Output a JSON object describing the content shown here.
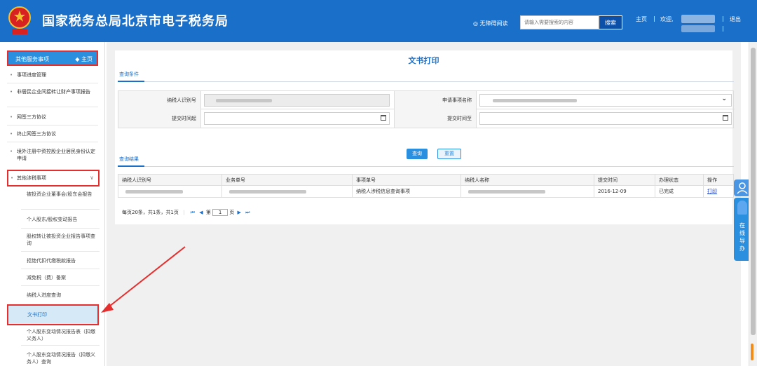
{
  "header": {
    "site_title": "国家税务总局北京市电子税务局",
    "accessibility": "◎ 无障碍阅读",
    "search_placeholder": "请输入需要搜索的内容",
    "search_button": "搜索",
    "home": "主页",
    "welcome": "欢迎,",
    "exit": "退出",
    "sep": "|"
  },
  "sidebar": {
    "header_label": "其他服务事项",
    "header_home": "◆ 主页",
    "items": [
      {
        "label": "事项进度管理"
      },
      {
        "label": "非居民企业间接转让财产事项报告"
      },
      {
        "label": "网签三方协议"
      },
      {
        "label": "终止网签三方协议"
      },
      {
        "label": "境外注册中资控股企业居民身份认定申请"
      }
    ],
    "group_label": "其他涉税事项",
    "sub_items": [
      {
        "label": "被投资企业董事会/股东会报告"
      },
      {
        "label": "个人股东/股权变动报告"
      },
      {
        "label": "股权转让被投资企业报告事项查询"
      },
      {
        "label": "拒绝代扣代缴税款报告"
      },
      {
        "label": "减免税（费）备案"
      },
      {
        "label": "纳税人进度查询"
      },
      {
        "label": "文书打印"
      },
      {
        "label": "个人股东变动情况报告表（扣缴义务人）"
      },
      {
        "label": "个人股东变动情况报告（扣缴义务人）查询"
      }
    ]
  },
  "main": {
    "title": "文书打印",
    "query_tab": "查询条件",
    "result_tab": "查询结果",
    "form": {
      "taxpayer_id_label": "纳税人识别号",
      "apply_item_label": "申请事项名称",
      "start_time_label": "提交时间起",
      "end_time_label": "提交时间至"
    },
    "query_button": "查询",
    "reset_button": "重置",
    "table": {
      "headers": [
        "纳税人识别号",
        "业务单号",
        "事项单号",
        "纳税人名称",
        "提交时间",
        "办理状态",
        "操作"
      ],
      "row": {
        "item_no": "纳税人涉税信息查询事项",
        "submit_time": "2016-12-09",
        "status": "已完成",
        "action": "打印"
      }
    },
    "pager": {
      "summary": "每页20条，共1条，共1页",
      "page_prefix": "第",
      "page_value": "1",
      "page_suffix": "页"
    }
  },
  "float_widget": {
    "label": "在线导办"
  },
  "colors": {
    "header_bg": "#1a6fc9",
    "accent": "#2b8fe0",
    "highlight_border": "#e52e2e",
    "active_bg": "#d5e9f7"
  }
}
